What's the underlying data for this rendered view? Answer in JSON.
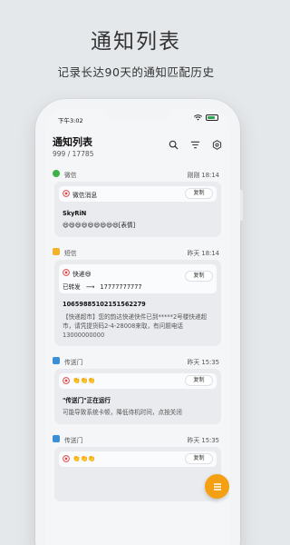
{
  "promo": {
    "title": "通知列表",
    "subtitle": "记录长达90天的通知匹配历史"
  },
  "status_bar": {
    "time": "下午3:02"
  },
  "header": {
    "title": "通知列表",
    "count": "999 / 17785",
    "icons": [
      "search-icon",
      "filter-icon",
      "settings-icon"
    ]
  },
  "messages": [
    {
      "app": "微信",
      "app_color": "#3cb34a",
      "time": "刚刚 18:14",
      "rule": "微信消息",
      "copy_label": "复制",
      "lines": [
        "SkyRiN",
        "😄😄😄😄😄😄😄😄😄[表情]"
      ]
    },
    {
      "app": "短信",
      "app_color": "#f0b429",
      "time": "昨天 18:14",
      "rule": "快递😄",
      "copy_label": "复制",
      "forward_label": "已转发",
      "forward_target": "17777777777",
      "lines": [
        "1065988510215156227​9",
        "【快递超市】您的韵达快递快件已到*****2号楼快递超市，请凭提货码2-4-28008来取，有问题电话13000000000"
      ]
    },
    {
      "app": "传送门",
      "app_color": "#3b8fd6",
      "time": "昨天 15:35",
      "rule": "👏👏👏",
      "copy_label": "复制",
      "lines": [
        "\"传送门\"正在运行",
        "可能导致系统卡顿，降低待机时间，点按关闭"
      ]
    },
    {
      "app": "传送门",
      "app_color": "#3b8fd6",
      "time": "昨天 15:35",
      "rule": "👏👏👏",
      "copy_label": "复制",
      "lines": []
    }
  ],
  "fab": {
    "icon": "menu-icon",
    "color": "#f5a012"
  }
}
